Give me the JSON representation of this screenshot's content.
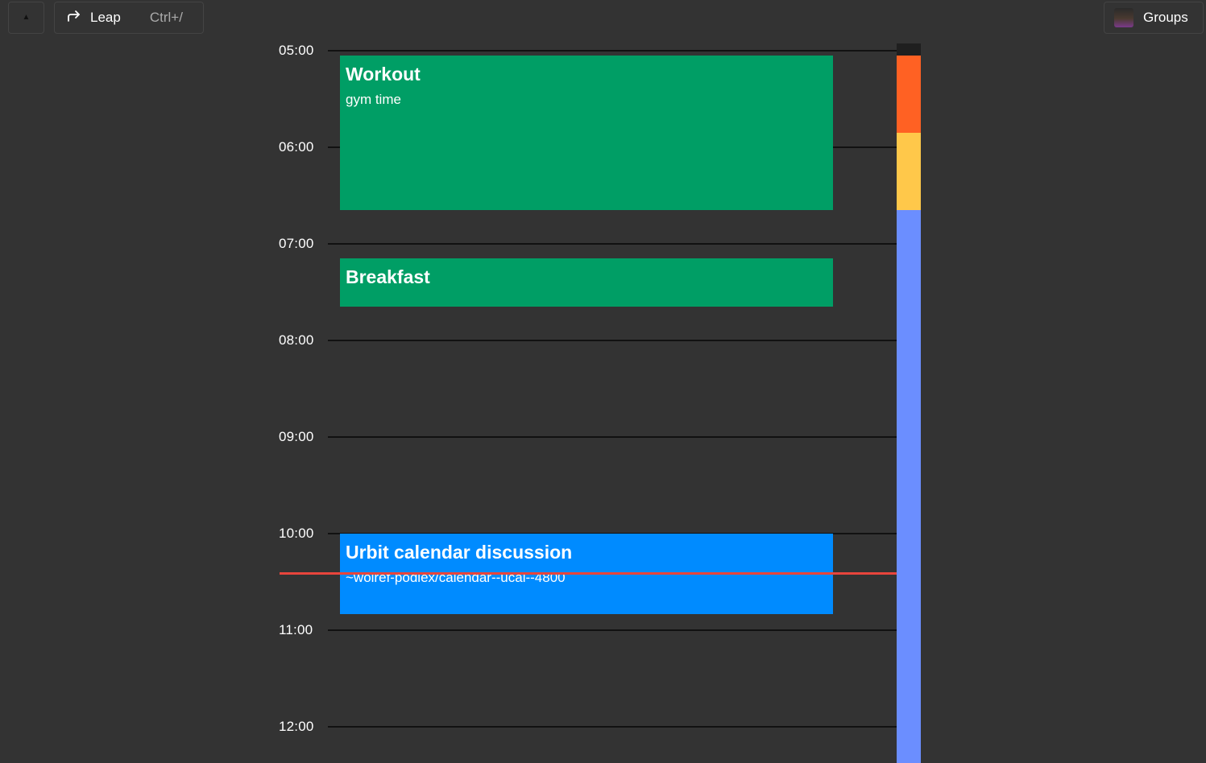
{
  "topbar": {
    "home": {
      "icon": "home-icon"
    },
    "leap": {
      "icon": "arrow-redirect-icon",
      "label": "Leap",
      "shortcut": "Ctrl+/"
    },
    "groups": {
      "avatar": "avatar-icon",
      "label": "Groups"
    }
  },
  "calendar": {
    "hours": [
      "05:00",
      "06:00",
      "07:00",
      "08:00",
      "09:00",
      "10:00",
      "11:00",
      "12:00"
    ],
    "events": [
      {
        "title": "Workout",
        "description": "gym time",
        "color": "#009E65"
      },
      {
        "title": "Breakfast",
        "description": "",
        "color": "#009E65"
      },
      {
        "title": "Urbit calendar discussion",
        "description": "~wolref-podlex/calendar--ucal--4800",
        "color": "#008BFF"
      }
    ],
    "now_indicator_color": "#E8453C",
    "strip_colors": [
      "#1F1F1F",
      "#FF6123",
      "#FFC84A",
      "#6B8EFF"
    ]
  }
}
